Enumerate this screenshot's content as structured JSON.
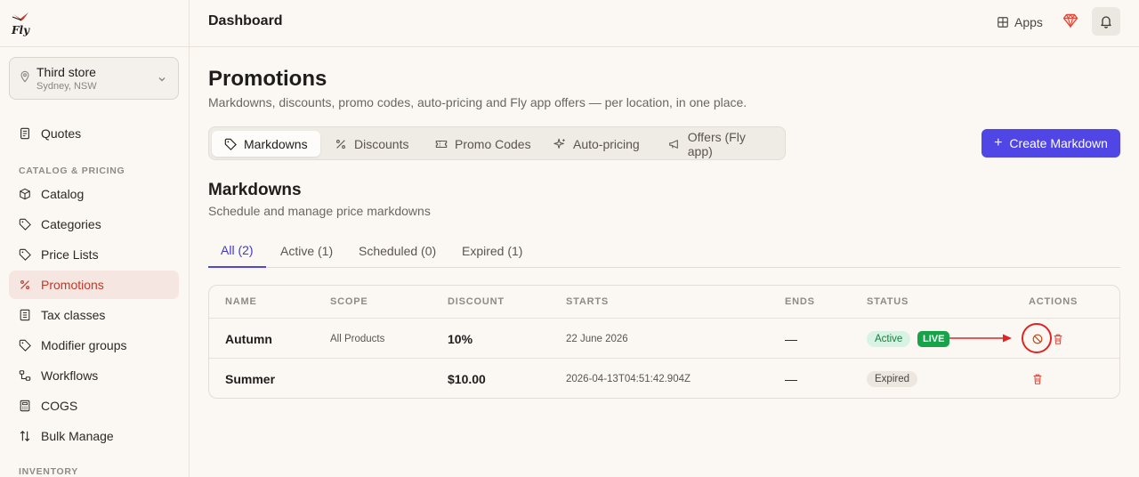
{
  "app": {
    "logo_text": "Fly",
    "brand_color": "#4f46e5",
    "danger_color": "#e02424"
  },
  "topbar": {
    "title": "Dashboard",
    "apps_label": "Apps",
    "gem_icon": "gem-icon",
    "bell_icon": "bell-icon"
  },
  "store": {
    "name": "Third store",
    "location": "Sydney, NSW"
  },
  "sidebar": {
    "items": [
      {
        "label": "Quotes",
        "icon": "document-icon"
      },
      {
        "label": "Catalog",
        "icon": "box-icon"
      },
      {
        "label": "Categories",
        "icon": "tag-icon"
      },
      {
        "label": "Price Lists",
        "icon": "tag-icon"
      },
      {
        "label": "Promotions",
        "icon": "percent-icon"
      },
      {
        "label": "Tax classes",
        "icon": "receipt-icon"
      },
      {
        "label": "Modifier groups",
        "icon": "tag-icon"
      },
      {
        "label": "Workflows",
        "icon": "workflow-icon"
      },
      {
        "label": "COGS",
        "icon": "calculator-icon"
      },
      {
        "label": "Bulk Manage",
        "icon": "sort-arrows-icon"
      }
    ],
    "sections": {
      "catalog_pricing": "CATALOG & PRICING",
      "inventory": "INVENTORY"
    }
  },
  "page": {
    "title": "Promotions",
    "subtitle": "Markdowns, discounts, promo codes, auto-pricing and Fly app offers — per location, in one place.",
    "create_button": "Create Markdown"
  },
  "tabs": [
    {
      "label": "Markdowns",
      "icon": "tag-icon"
    },
    {
      "label": "Discounts",
      "icon": "percent-icon"
    },
    {
      "label": "Promo Codes",
      "icon": "ticket-icon"
    },
    {
      "label": "Auto-pricing",
      "icon": "sparkle-icon"
    },
    {
      "label": "Offers (Fly app)",
      "icon": "megaphone-icon"
    }
  ],
  "section": {
    "title": "Markdowns",
    "subtitle": "Schedule and manage price markdowns"
  },
  "subtabs": [
    {
      "label": "All (2)"
    },
    {
      "label": "Active (1)"
    },
    {
      "label": "Scheduled (0)"
    },
    {
      "label": "Expired (1)"
    }
  ],
  "table": {
    "headers": [
      "NAME",
      "SCOPE",
      "DISCOUNT",
      "STARTS",
      "ENDS",
      "STATUS",
      "ACTIONS"
    ],
    "rows": [
      {
        "name": "Autumn",
        "scope": "All Products",
        "discount": "10%",
        "starts": "22 June 2026",
        "ends": "—",
        "status": "Active",
        "live": "LIVE"
      },
      {
        "name": "Summer",
        "scope": "",
        "discount": "$10.00",
        "starts": "2026-04-13T04:51:42.904Z",
        "ends": "—",
        "status": "Expired",
        "live": ""
      }
    ]
  }
}
